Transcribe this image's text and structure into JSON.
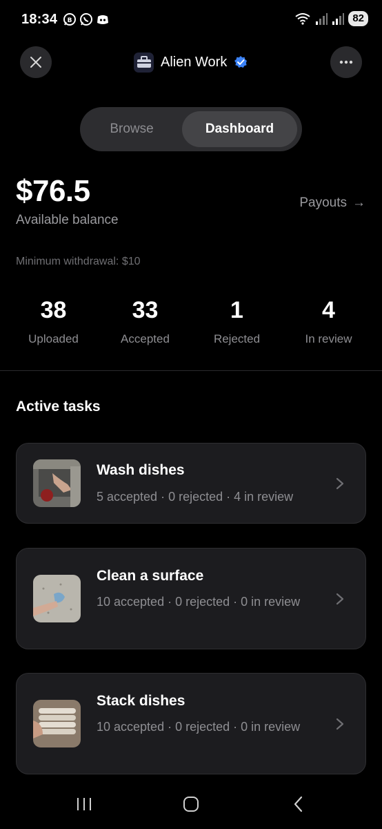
{
  "status_bar": {
    "time": "18:34",
    "battery": "82",
    "icons_left": [
      "whatsapp-business-icon",
      "whatsapp-icon",
      "discord-icon"
    ],
    "icons_right": [
      "wifi-icon",
      "signal-icon",
      "signal-icon"
    ]
  },
  "header": {
    "app_name": "Alien Work",
    "verified": true
  },
  "tabs": [
    {
      "label": "Browse",
      "active": false
    },
    {
      "label": "Dashboard",
      "active": true
    }
  ],
  "balance": {
    "amount": "$76.5",
    "label": "Available balance",
    "payouts_label": "Payouts",
    "payouts_arrow": "→",
    "minimum": "Minimum withdrawal: $10"
  },
  "stats": [
    {
      "value": "38",
      "label": "Uploaded"
    },
    {
      "value": "33",
      "label": "Accepted"
    },
    {
      "value": "1",
      "label": "Rejected"
    },
    {
      "value": "4",
      "label": "In review"
    }
  ],
  "active_tasks": {
    "title": "Active tasks",
    "items": [
      {
        "title": "Wash dishes",
        "subtitle": "5 accepted · 0 rejected · 4 in review"
      },
      {
        "title": "Clean a surface",
        "subtitle": "10 accepted · 0 rejected · 0 in review"
      },
      {
        "title": "Stack dishes",
        "subtitle": "10 accepted · 0 rejected · 0 in review"
      }
    ]
  },
  "colors": {
    "background": "#000000",
    "card": "#1c1c1f",
    "muted_text": "#8e8e92",
    "verified_badge": "#3b82f6"
  }
}
